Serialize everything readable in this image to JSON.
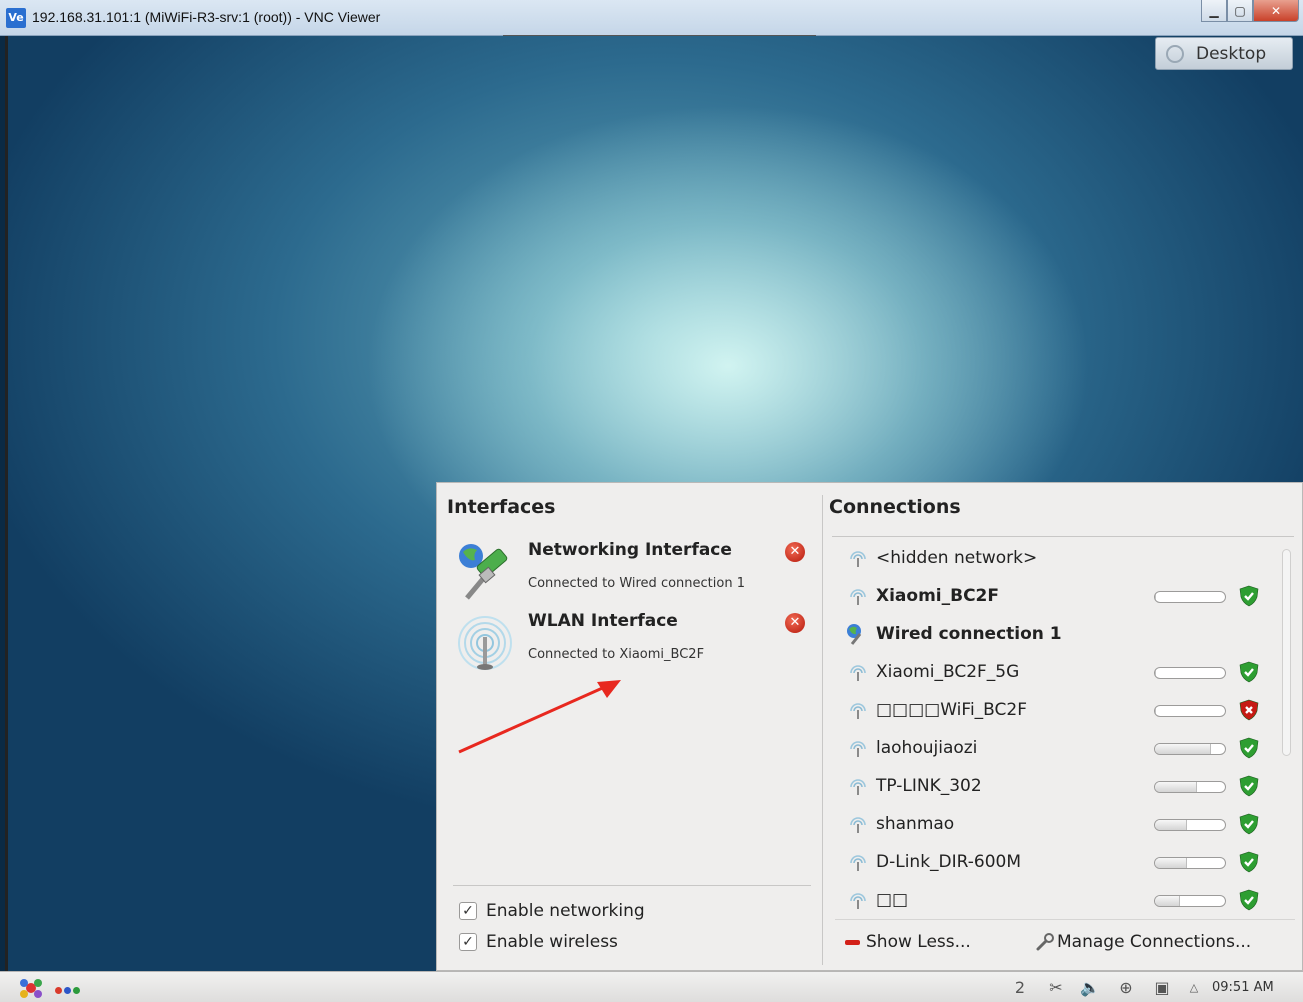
{
  "window": {
    "icon_text": "Ve",
    "title": "192.168.31.101:1 (MiWiFi-R3-srv:1 (root)) - VNC Viewer",
    "controls": {
      "minimize": "▁",
      "maximize": "▢",
      "close": "✕"
    }
  },
  "desktop": {
    "button_label": "Desktop"
  },
  "interfaces": {
    "heading": "Interfaces",
    "items": [
      {
        "name": "Networking Interface",
        "status": "Connected to Wired connection 1",
        "icon": "wired-network-icon"
      },
      {
        "name": "WLAN Interface",
        "status": "Connected to Xiaomi_BC2F",
        "icon": "wireless-antenna-icon"
      }
    ],
    "disconnect_glyph": "✕",
    "options": [
      {
        "label": "Enable networking",
        "checked": true
      },
      {
        "label": "Enable wireless",
        "checked": true
      }
    ]
  },
  "connections": {
    "heading": "Connections",
    "items": [
      {
        "label": "<hidden network>",
        "bold": false,
        "type": "wifi",
        "signal": null,
        "secure": null
      },
      {
        "label": "Xiaomi_BC2F",
        "bold": true,
        "type": "wifi",
        "signal": 0.0,
        "secure": "green"
      },
      {
        "label": "Wired connection 1",
        "bold": true,
        "type": "wired",
        "signal": null,
        "secure": null
      },
      {
        "label": "Xiaomi_BC2F_5G",
        "bold": false,
        "type": "wifi",
        "signal": 0.0,
        "secure": "green"
      },
      {
        "label": "   □□□□WiFi_BC2F",
        "bold": false,
        "type": "wifi",
        "signal": 0.0,
        "secure": "red"
      },
      {
        "label": "laohoujiaozi",
        "bold": false,
        "type": "wifi",
        "signal": 0.8,
        "secure": "green"
      },
      {
        "label": "TP-LINK_302",
        "bold": false,
        "type": "wifi",
        "signal": 0.6,
        "secure": "green"
      },
      {
        "label": "shanmao",
        "bold": false,
        "type": "wifi",
        "signal": 0.45,
        "secure": "green"
      },
      {
        "label": "D-Link_DIR-600M",
        "bold": false,
        "type": "wifi",
        "signal": 0.45,
        "secure": "green"
      },
      {
        "label": "□□",
        "bold": false,
        "type": "wifi",
        "signal": 0.35,
        "secure": "green"
      }
    ],
    "show_less": "Show Less...",
    "manage": "Manage Connections..."
  },
  "taskbar": {
    "clock": "09:51 AM",
    "tray_icons": [
      "clipboard-icon",
      "scissors-icon",
      "volume-icon",
      "network-icon",
      "printer-icon"
    ],
    "dot_colors": [
      "#d93a2b",
      "#2d56c8",
      "#2c9a3c"
    ],
    "pager": "2"
  },
  "colors": {
    "secure_green": "#2e9e32",
    "secure_red": "#c61b14",
    "annotation_arrow": "#e8281f"
  }
}
